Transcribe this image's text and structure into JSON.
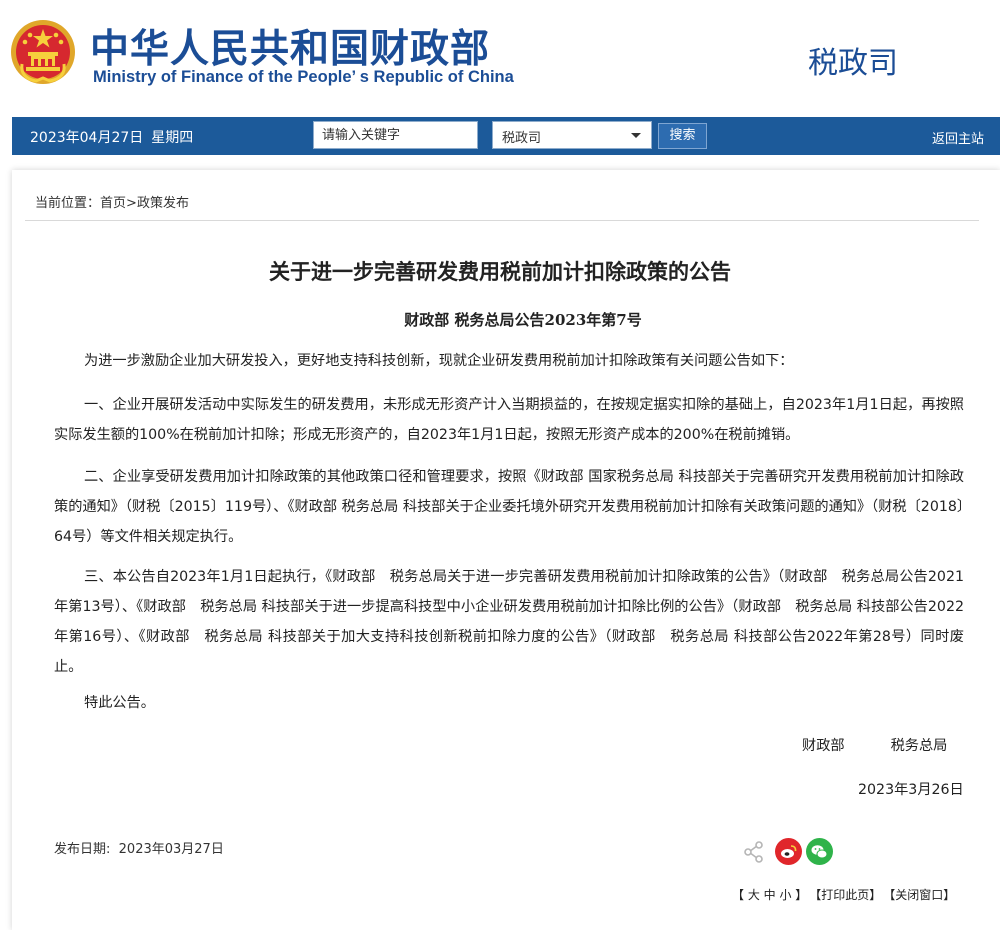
{
  "header": {
    "title_cn": "中华人民共和国财政部",
    "title_en": "Ministry of Finance of the People’ s Republic of China",
    "department": "税政司"
  },
  "nav": {
    "date": "2023年04月27日",
    "weekday": "星期四",
    "search_placeholder": "请输入关键字",
    "select_value": "税政司",
    "search_button": "搜索",
    "home_link": "返回主站",
    "bar_color": "#1c5a9a"
  },
  "breadcrumb": {
    "prefix": "当前位置：",
    "items": [
      "首页",
      "政策发布"
    ],
    "separator": ">"
  },
  "article": {
    "title": "关于进一步完善研发费用税前加计扣除政策的公告",
    "doc_number": "财政部  税务总局公告2023年第7号",
    "paragraphs": [
      "为进一步激励企业加大研发投入，更好地支持科技创新，现就企业研发费用税前加计扣除政策有关问题公告如下：",
      "一、企业开展研发活动中实际发生的研发费用，未形成无形资产计入当期损益的，在按规定据实扣除的基础上，自2023年1月1日起，再按照实际发生额的100%在税前加计扣除；形成无形资产的，自2023年1月1日起，按照无形资产成本的200%在税前摊销。",
      "二、企业享受研发费用加计扣除政策的其他政策口径和管理要求，按照《财政部 国家税务总局 科技部关于完善研究开发费用税前加计扣除政策的通知》（财税〔2015〕119号）、《财政部 税务总局 科技部关于企业委托境外研究开发费用税前加计扣除有关政策问题的通知》（财税〔2018〕64号）等文件相关规定执行。",
      "三、本公告自2023年1月1日起执行，《财政部　税务总局关于进一步完善研发费用税前加计扣除政策的公告》（财政部　税务总局公告2021年第13号）、《财政部　税务总局 科技部关于进一步提高科技型中小企业研发费用税前加计扣除比例的公告》（财政部　税务总局 科技部公告2022年第16号）、《财政部　税务总局 科技部关于加大支持科技创新税前扣除力度的公告》（财政部　税务总局 科技部公告2022年第28号）同时废止。",
      "特此公告。"
    ],
    "sign_orgs": [
      "财政部",
      "税务总局"
    ],
    "sign_date": "2023年3月26日"
  },
  "footer": {
    "publish_label": "发布日期:",
    "publish_date": "2023年03月27日",
    "font_size_tool": "【 大 中 小 】",
    "print_tool": "【打印此页】",
    "close_tool": "【关闭窗口】",
    "share_icons": [
      "share-icon",
      "weibo-icon",
      "wechat-icon"
    ],
    "weibo_color": "#e0262b",
    "wechat_color": "#2fb34a"
  }
}
